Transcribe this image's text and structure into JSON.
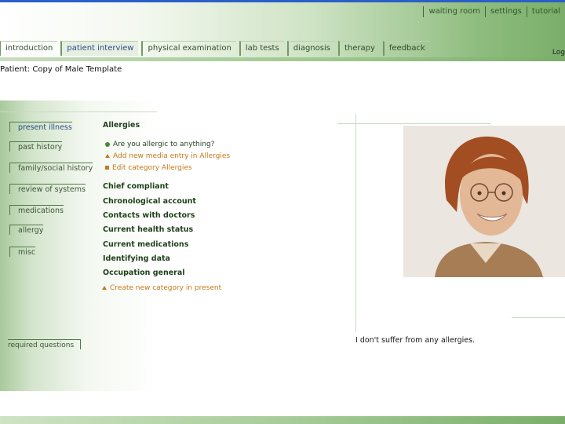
{
  "utility_nav": [
    "waiting room",
    "settings",
    "tutorial"
  ],
  "tabs": [
    {
      "label": "introduction",
      "active": false
    },
    {
      "label": "patient interview",
      "active": true
    },
    {
      "label": "physical examination",
      "active": false
    },
    {
      "label": "lab tests",
      "active": false
    },
    {
      "label": "diagnosis",
      "active": false
    },
    {
      "label": "therapy",
      "active": false
    },
    {
      "label": "feedback",
      "active": false
    }
  ],
  "logout_label": "Log",
  "patient_label": "Patient: Copy of Male Template",
  "sidebar": {
    "items": [
      {
        "label": "present illness",
        "active": true
      },
      {
        "label": "past history",
        "active": false
      },
      {
        "label": "family/social history",
        "active": false
      },
      {
        "label": "review of systems",
        "active": false
      },
      {
        "label": "medications",
        "active": false
      },
      {
        "label": "allergy",
        "active": false
      },
      {
        "label": "misc",
        "active": false
      }
    ],
    "required_label": "required questions"
  },
  "middle": {
    "section_title": "Allergies",
    "actions": [
      {
        "label": "Are you allergic to anything?",
        "color": "#1f3f1b",
        "bullet": "circle",
        "bullet_color": "#3f8a3f"
      },
      {
        "label": "Add new media entry in Allergies",
        "color": "#c47a1a",
        "bullet": "triangle",
        "bullet_color": "#c47a1a"
      },
      {
        "label": "Edit category Allergies",
        "color": "#c47a1a",
        "bullet": "square",
        "bullet_color": "#c47a1a"
      }
    ],
    "categories": [
      "Chief compliant",
      "Chronological account",
      "Contacts with doctors",
      "Current health status",
      "Current medications",
      "Identifying data",
      "Occupation general"
    ],
    "create_label": "Create new category in present"
  },
  "answer_text": "I don't suffer from any allergies."
}
